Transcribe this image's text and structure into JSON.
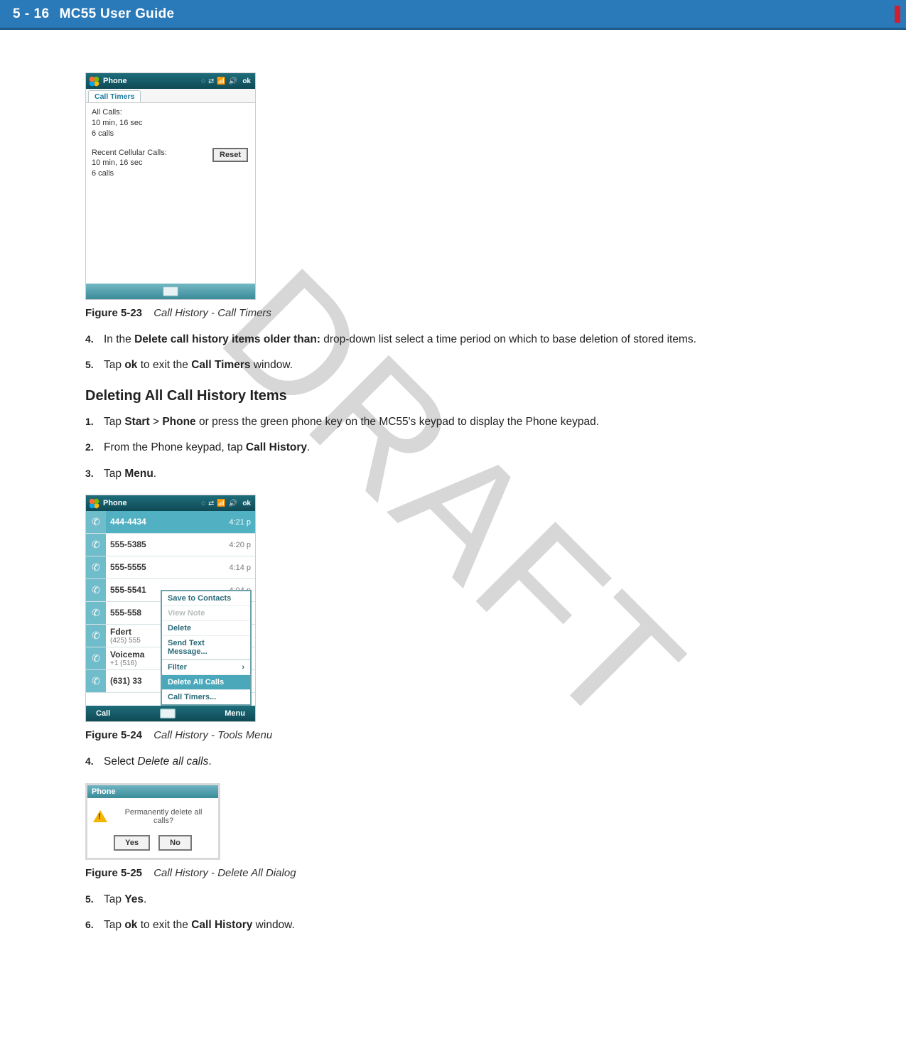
{
  "header": {
    "page_number": "5 - 16",
    "guide_title": "MC55 User Guide"
  },
  "watermark": "DRAFT",
  "fig23": {
    "label": "Figure 5-23",
    "caption": "Call History - Call Timers",
    "titlebar": {
      "title": "Phone",
      "ok": "ok"
    },
    "tab": "Call Timers",
    "all_calls": {
      "label": "All Calls:",
      "duration": "10 min, 16 sec",
      "count": "6 calls"
    },
    "recent": {
      "label": "Recent Cellular Calls:",
      "duration": "10 min, 16 sec",
      "count": "6 calls"
    },
    "reset_label": "Reset"
  },
  "steps_a": {
    "s4_num": "4.",
    "s4_a": "In the ",
    "s4_b": "Delete call history items older than:",
    "s4_c": " drop-down list select a time period on which to base deletion of stored items.",
    "s5_num": "5.",
    "s5_a": "Tap ",
    "s5_b": "ok",
    "s5_c": " to exit the ",
    "s5_d": "Call Timers",
    "s5_e": " window."
  },
  "section_heading": "Deleting All Call History Items",
  "steps_b": {
    "s1_num": "1.",
    "s1_a": "Tap ",
    "s1_b": "Start",
    "s1_c": " > ",
    "s1_d": "Phone",
    "s1_e": " or press the green phone key on the MC55's keypad to display the Phone keypad.",
    "s2_num": "2.",
    "s2_a": "From the Phone keypad, tap ",
    "s2_b": "Call History",
    "s2_c": ".",
    "s3_num": "3.",
    "s3_a": "Tap ",
    "s3_b": "Menu",
    "s3_c": "."
  },
  "fig24": {
    "label": "Figure 5-24",
    "caption": "Call History - Tools Menu",
    "titlebar": {
      "title": "Phone",
      "ok": "ok"
    },
    "rows": [
      {
        "num": "444-4434",
        "sub": "",
        "time": "4:21 p",
        "selected": true
      },
      {
        "num": "555-5385",
        "sub": "",
        "time": "4:20 p",
        "selected": false
      },
      {
        "num": "555-5555",
        "sub": "",
        "time": "4:14 p",
        "selected": false
      },
      {
        "num": "555-5541",
        "sub": "",
        "time": "4:04 p",
        "selected": false
      },
      {
        "num": "555-558",
        "sub": "",
        "time": "",
        "selected": false
      },
      {
        "num": "Fdert",
        "sub": "(425) 555",
        "time": "",
        "selected": false
      },
      {
        "num": "Voicema",
        "sub": "+1 (516)",
        "time": "",
        "selected": false
      },
      {
        "num": "(631) 33",
        "sub": "",
        "time": "",
        "selected": false
      }
    ],
    "menu": {
      "save": "Save to Contacts",
      "view": "View Note",
      "delete": "Delete",
      "sendtxt": "Send Text Message...",
      "filter": "Filter",
      "delall": "Delete All Calls",
      "timers": "Call Timers..."
    },
    "softkeys": {
      "left": "Call",
      "right": "Menu"
    }
  },
  "steps_c": {
    "s4_num": "4.",
    "s4_a": "Select ",
    "s4_b": "Delete all calls",
    "s4_c": "."
  },
  "fig25": {
    "label": "Figure 5-25",
    "caption": "Call History - Delete All Dialog",
    "dlg_title": "Phone",
    "dlg_msg": "Permanently delete all calls?",
    "yes": "Yes",
    "no": "No"
  },
  "steps_d": {
    "s5_num": "5.",
    "s5_a": "Tap ",
    "s5_b": "Yes",
    "s5_c": ".",
    "s6_num": "6.",
    "s6_a": "Tap ",
    "s6_b": "ok",
    "s6_c": " to exit the ",
    "s6_d": "Call History",
    "s6_e": " window."
  }
}
